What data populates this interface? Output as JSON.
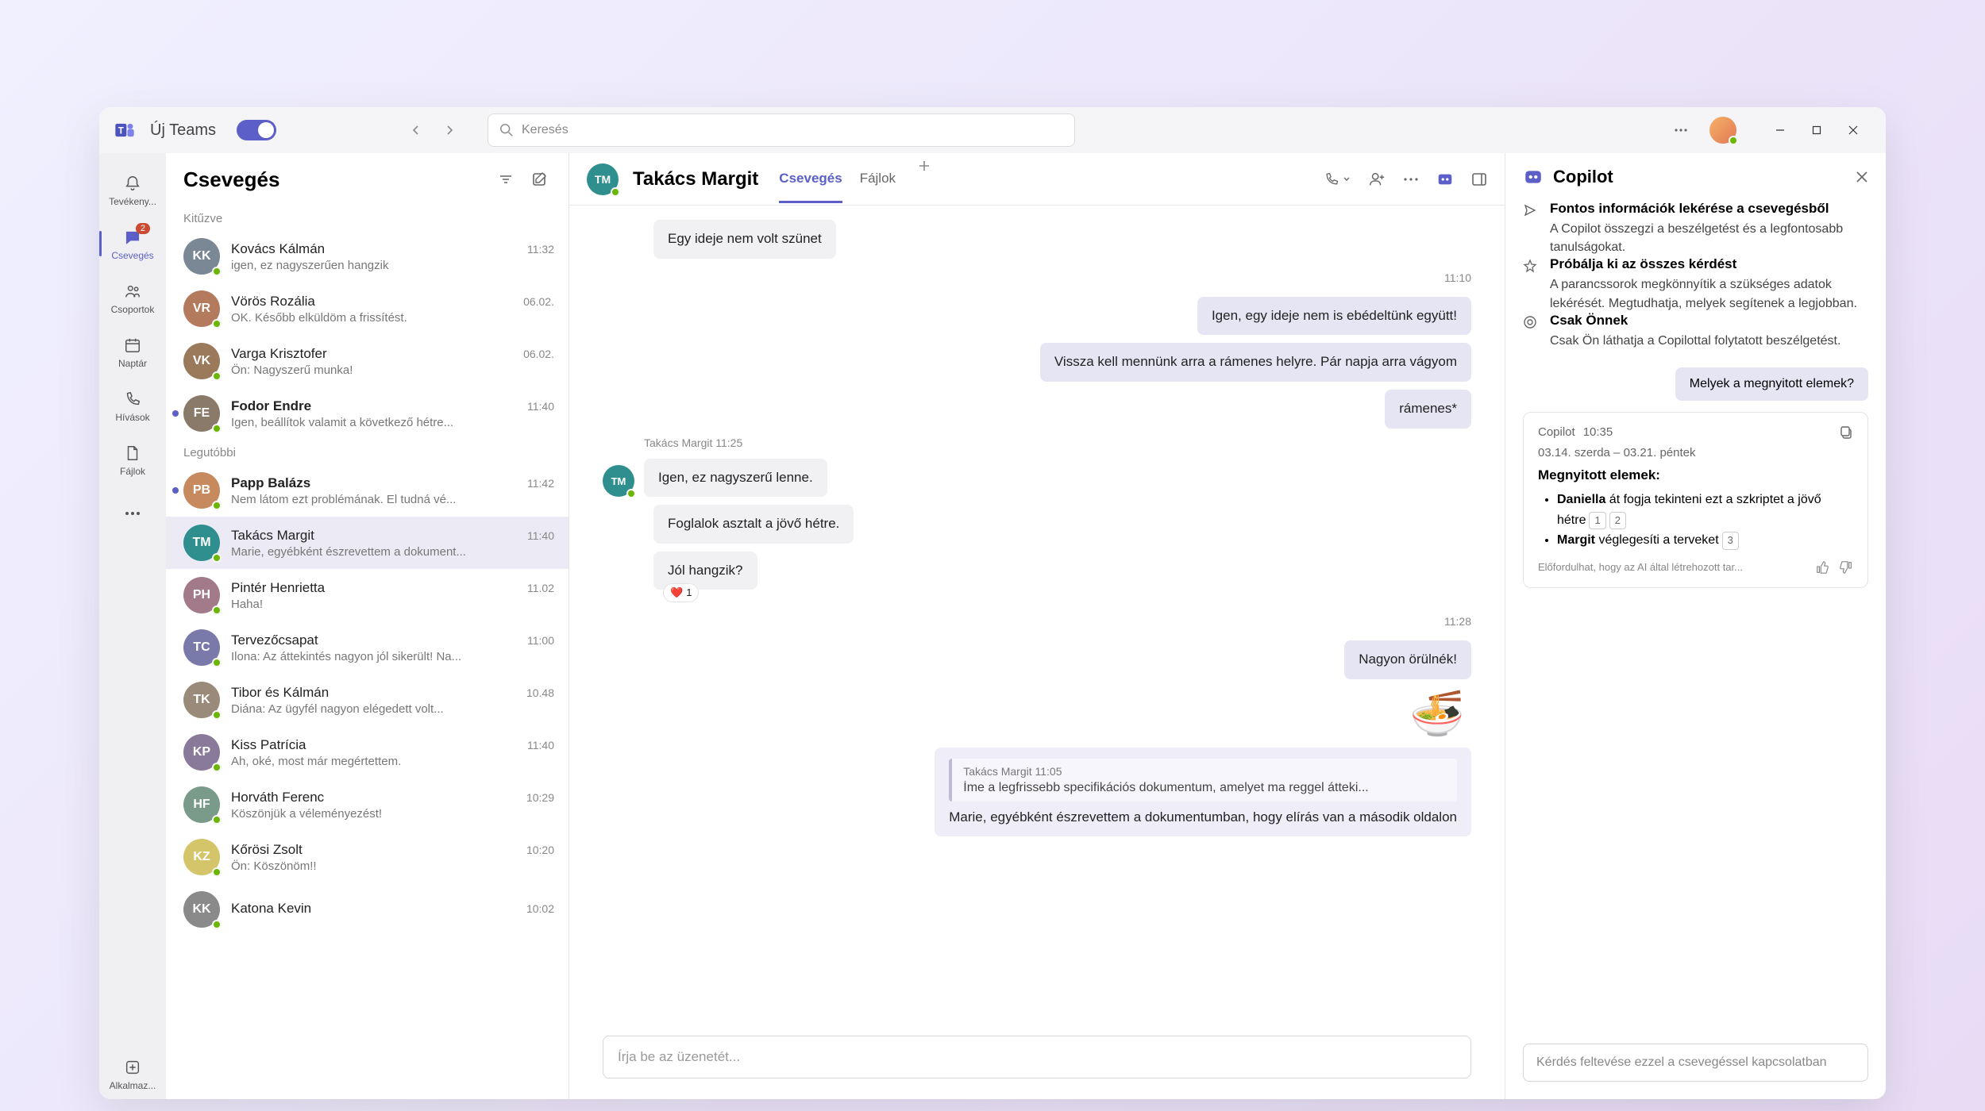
{
  "titlebar": {
    "app_name": "Új Teams",
    "search_placeholder": "Keresés"
  },
  "rail": {
    "badge": "2",
    "items": [
      {
        "label": "Tevékeny..."
      },
      {
        "label": "Csevegés"
      },
      {
        "label": "Csoportok"
      },
      {
        "label": "Naptár"
      },
      {
        "label": "Hívások"
      },
      {
        "label": "Fájlok"
      }
    ],
    "apps_label": "Alkalmaz..."
  },
  "chat_list": {
    "title": "Csevegés",
    "pinned_label": "Kitűzve",
    "recent_label": "Legutóbbi",
    "pinned": [
      {
        "name": "Kovács Kálmán",
        "preview": "igen, ez nagyszerűen hangzik",
        "time": "11:32",
        "initials": "KK",
        "color": "#7a8896"
      },
      {
        "name": "Vörös Rozália",
        "preview": "OK. Később elküldöm a frissítést.",
        "time": "06.02.",
        "initials": "VR",
        "color": "#b37a5e"
      },
      {
        "name": "Varga Krisztofer",
        "preview": "Ön: Nagyszerű munka!",
        "time": "06.02.",
        "initials": "VK",
        "color": "#9a7a5a"
      },
      {
        "name": "Fodor Endre",
        "preview": "Igen, beállítok valamit a következő hétre...",
        "time": "11:40",
        "initials": "FE",
        "color": "#8a7a6a",
        "unread": true
      }
    ],
    "recent": [
      {
        "name": "Papp Balázs",
        "preview": "Nem látom ezt problémának. El tudná vé...",
        "time": "11:42",
        "initials": "PB",
        "color": "#c78a5e",
        "unread": true
      },
      {
        "name": "Takács Margit",
        "preview": "Marie, egyébként észrevettem a dokument...",
        "time": "11:40",
        "initials": "TM",
        "color": "#2f8f8f",
        "selected": true
      },
      {
        "name": "Pintér Henrietta",
        "preview": "Haha!",
        "time": "11.02",
        "initials": "PH",
        "color": "#a27a8a"
      },
      {
        "name": "Tervezőcsapat",
        "preview": "Ilona: Az áttekintés nagyon jól sikerült! Na...",
        "time": "11:00",
        "initials": "TC",
        "color": "#7a7aaa"
      },
      {
        "name": "Tibor és Kálmán",
        "preview": "Diána: Az ügyfél nagyon elégedett volt...",
        "time": "10.48",
        "initials": "TK",
        "color": "#9a8a7a"
      },
      {
        "name": "Kiss Patrícia",
        "preview": "Ah, oké, most már megértettem.",
        "time": "11:40",
        "initials": "KP",
        "color": "#8a7a9a"
      },
      {
        "name": "Horváth Ferenc",
        "preview": "Köszönjük a véleményezést!",
        "time": "10:29",
        "initials": "HF",
        "color": "#7a9a8a"
      },
      {
        "name": "Kőrösi Zsolt",
        "preview": "Ön: Köszönöm!!",
        "time": "10:20",
        "initials": "KZ",
        "color": "#d4c56a"
      },
      {
        "name": "Katona Kevin",
        "preview": "",
        "time": "10:02",
        "initials": "KK",
        "color": "#8a8a8a"
      }
    ]
  },
  "conversation": {
    "title": "Takács Margit",
    "initials": "TM",
    "tabs": [
      {
        "label": "Csevegés",
        "active": true
      },
      {
        "label": "Fájlok"
      }
    ],
    "thread": {
      "other0": "Egy ideje nem volt szünet",
      "t1": "11:10",
      "me1": "Igen, egy ideje nem is ebédeltünk együtt!",
      "me2": "Vissza kell mennünk arra a rámenes helyre. Pár napja arra vágyom",
      "me3": "rámenes*",
      "meta_other": "Takács Margit   11:25",
      "other1": "Igen, ez nagyszerű lenne.",
      "other2": "Foglalok asztalt a jövő hétre.",
      "other3": "Jól hangzik?",
      "reaction_count": "1",
      "t2": "11:28",
      "me4": "Nagyon örülnék!",
      "quote_meta": "Takács Margit   11:05",
      "quote_text": "Íme a legfrissebb specifikációs dokumentum, amelyet ma reggel átteki...",
      "quote_reply": "Marie, egyébként észrevettem a dokumentumban, hogy elírás van a második oldalon"
    },
    "composer_placeholder": "Írja be az üzenetét..."
  },
  "copilot": {
    "title": "Copilot",
    "items": [
      {
        "title": "Fontos információk lekérése a csevegésből",
        "body": "A Copilot összegzi a beszélgetést és a legfontosabb tanulságokat."
      },
      {
        "title": "Próbálja ki az összes kérdést",
        "body": "A parancssorok megkönnyítik a szükséges adatok lekérését. Megtudhatja, melyek segítenek a legjobban."
      },
      {
        "title": "Csak Önnek",
        "body": "Csak Ön láthatja a Copilottal folytatott beszélgetést."
      }
    ],
    "user_prompt": "Melyek a megnyitott elemek?",
    "response": {
      "sender": "Copilot",
      "time": "10:35",
      "date": "03.14. szerda – 03.21. péntek",
      "title": "Megnyitott elemek:",
      "li1_a": "Daniella",
      "li1_b": " át fogja tekinteni ezt a szkriptet a jövő hétre",
      "li2_a": "Margit",
      "li2_b": " véglegesíti a terveket",
      "ref1": "1",
      "ref2": "2",
      "ref3": "3",
      "disclaimer": "Előfordulhat, hogy az AI által létrehozott tar..."
    },
    "input_placeholder": "Kérdés feltevése ezzel a csevegéssel kapcsolatban"
  }
}
